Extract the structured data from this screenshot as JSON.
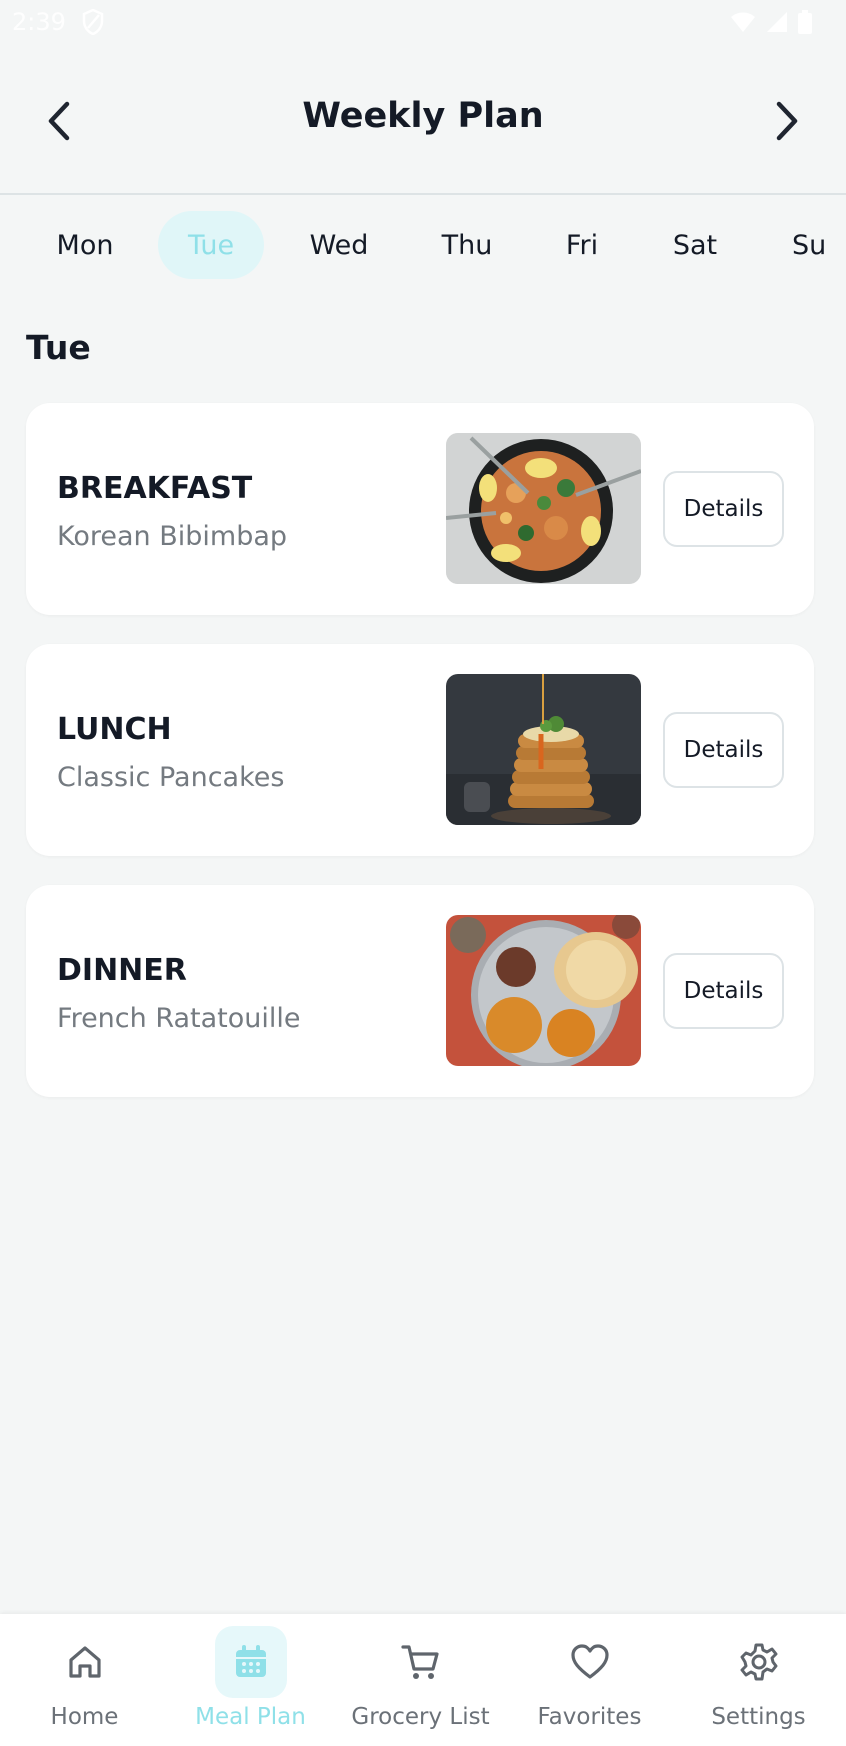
{
  "status_bar": {
    "time": "2:39",
    "icons": [
      "shield-icon",
      "wifi-icon",
      "signal-icon",
      "battery-icon"
    ]
  },
  "header": {
    "title": "Weekly Plan",
    "prev_icon": "chevron-left-icon",
    "next_icon": "chevron-right-icon"
  },
  "days": [
    {
      "label": "Mon",
      "active": false
    },
    {
      "label": "Tue",
      "active": true
    },
    {
      "label": "Wed",
      "active": false
    },
    {
      "label": "Thu",
      "active": false
    },
    {
      "label": "Fri",
      "active": false
    },
    {
      "label": "Sat",
      "active": false
    },
    {
      "label": "Su",
      "active": false
    }
  ],
  "selected_day_heading": "Tue",
  "meals": [
    {
      "type": "BREAKFAST",
      "name": "Korean Bibimbap",
      "button": "Details",
      "image": "bibimbap-photo"
    },
    {
      "type": "LUNCH",
      "name": "Classic Pancakes",
      "button": "Details",
      "image": "pancakes-photo"
    },
    {
      "type": "DINNER",
      "name": "French Ratatouille",
      "button": "Details",
      "image": "thali-photo"
    }
  ],
  "bottom_nav": [
    {
      "label": "Home",
      "icon": "home-icon",
      "active": false
    },
    {
      "label": "Meal Plan",
      "icon": "calendar-icon",
      "active": true
    },
    {
      "label": "Grocery List",
      "icon": "cart-icon",
      "active": false
    },
    {
      "label": "Favorites",
      "icon": "heart-icon",
      "active": false
    },
    {
      "label": "Settings",
      "icon": "gear-icon",
      "active": false
    }
  ],
  "colors": {
    "background": "#f4f6f6",
    "accent": "#8fe0e8",
    "accent_bg": "#e0f6f8",
    "text_primary": "#141a26",
    "text_secondary": "#747a80"
  }
}
